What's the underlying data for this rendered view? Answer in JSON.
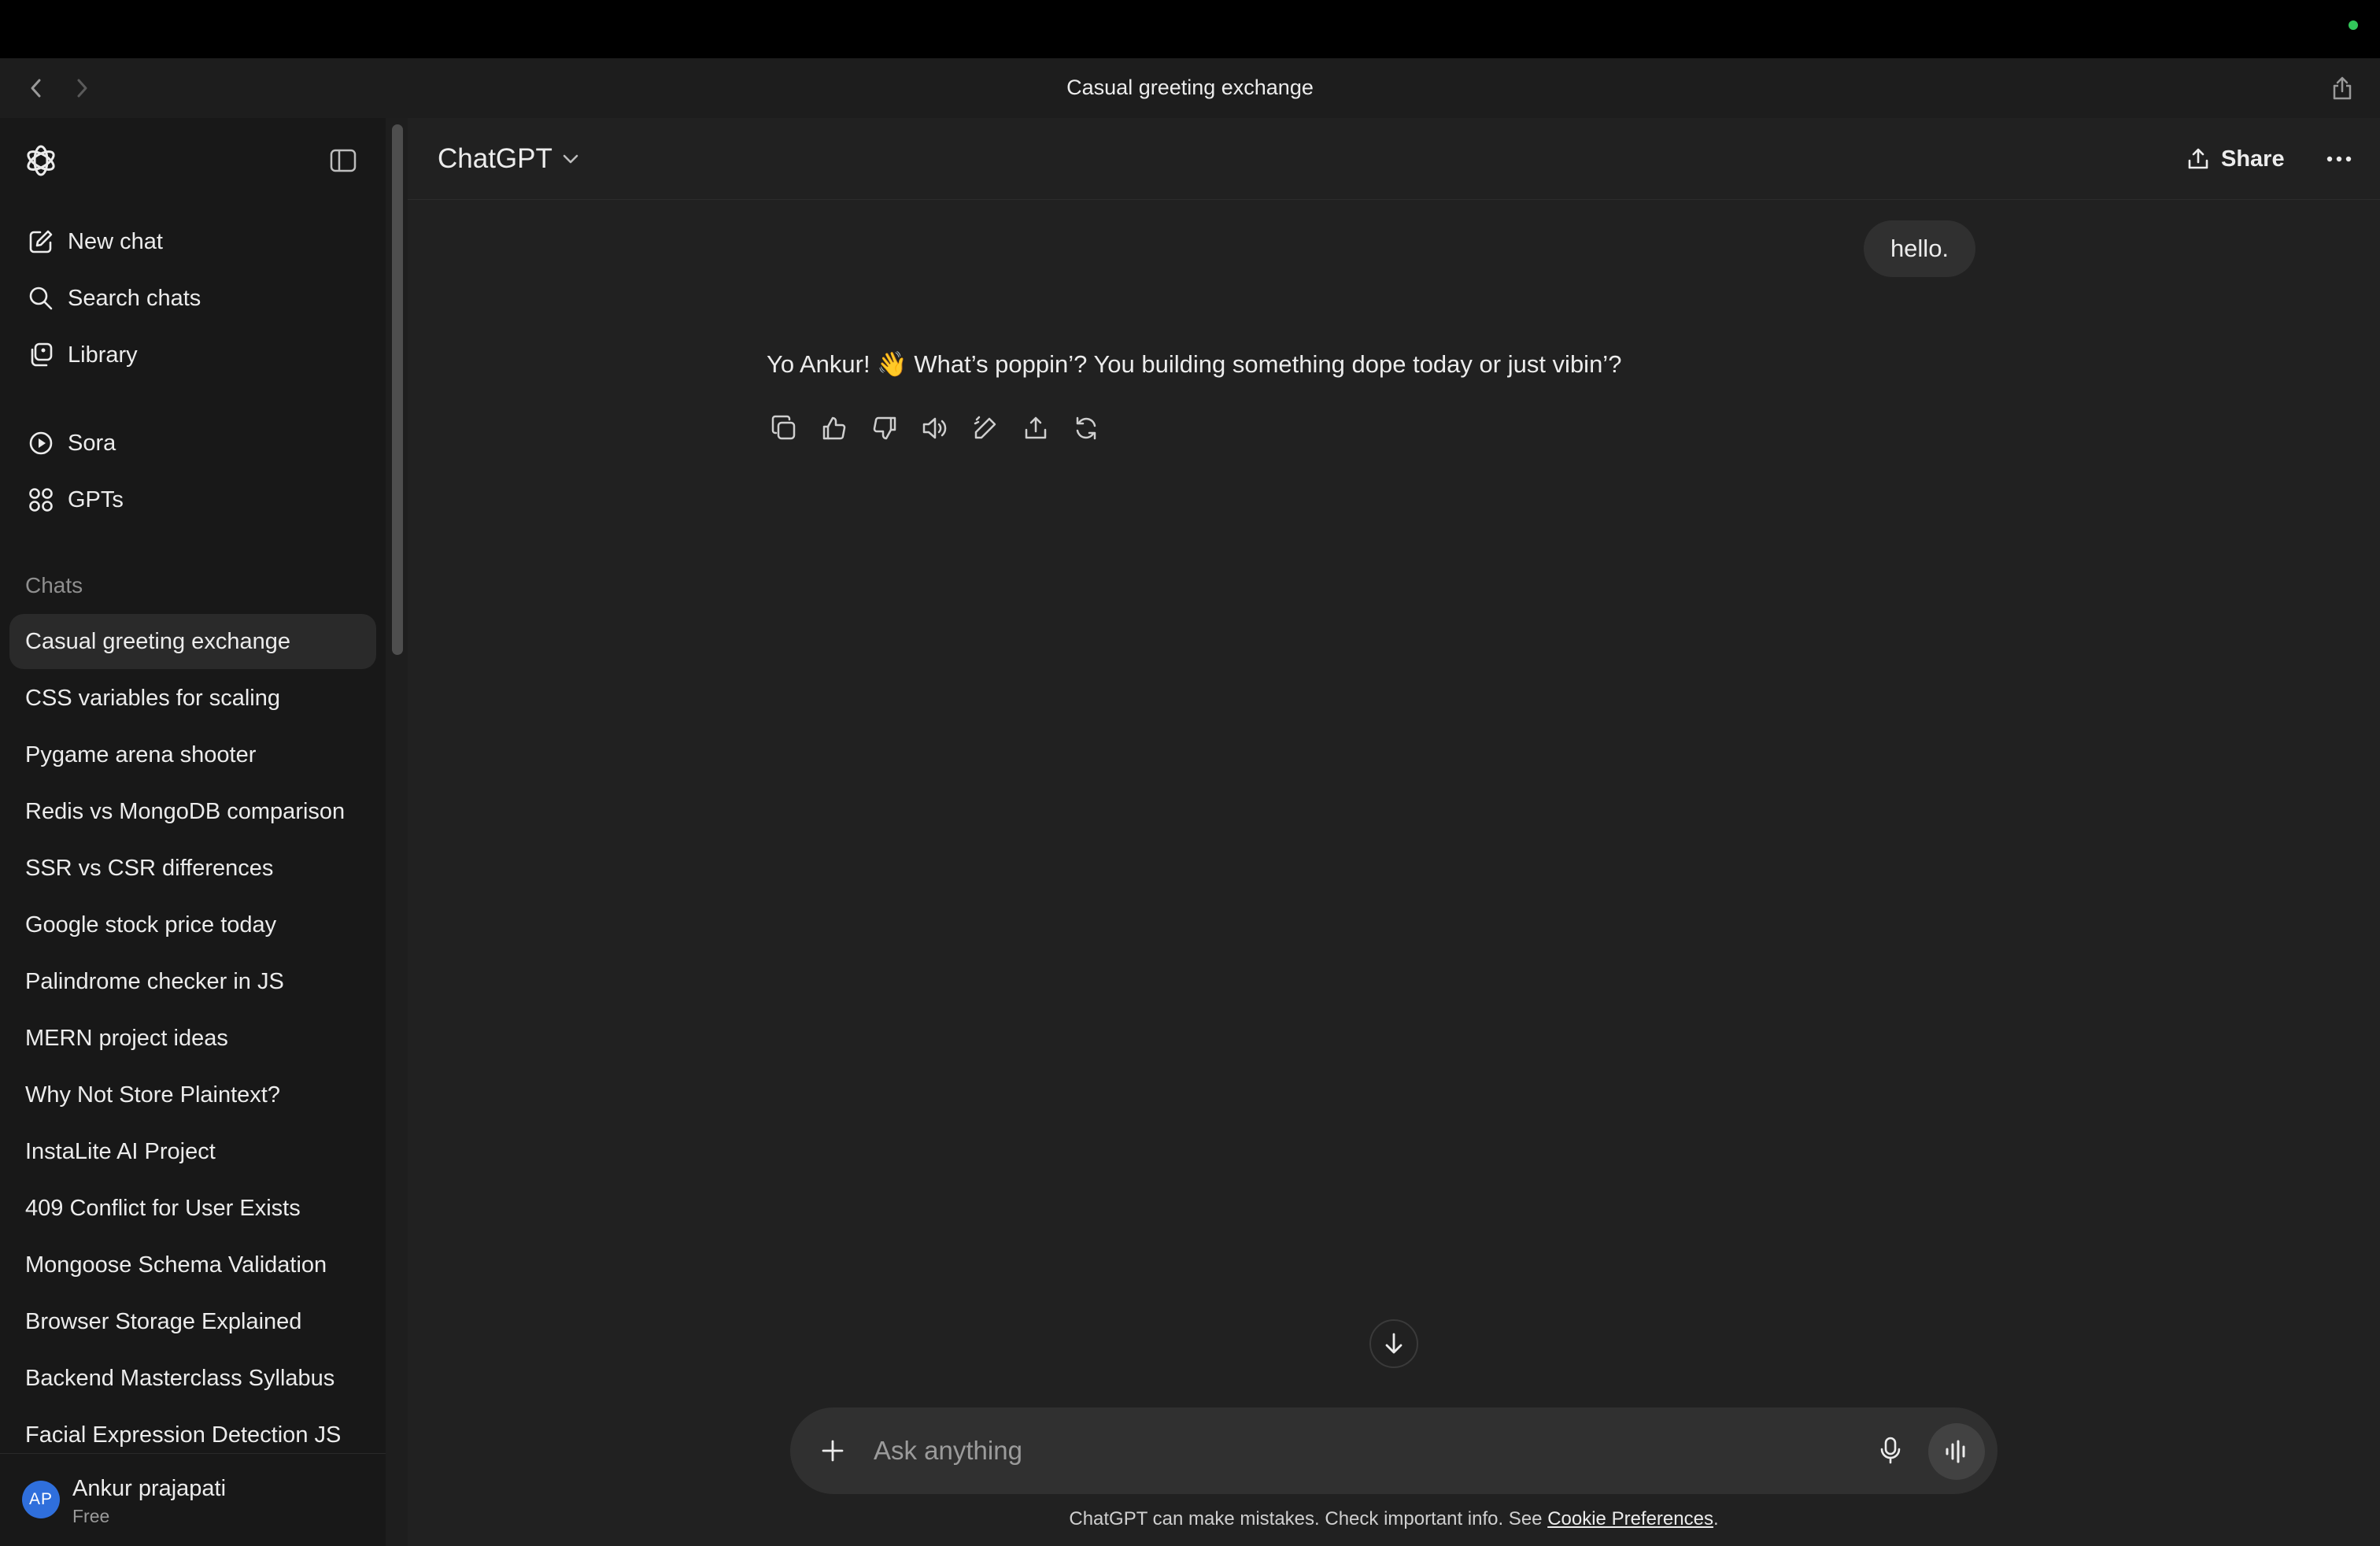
{
  "window": {
    "title": "Casual greeting exchange",
    "status_dot_color": "#32c75a"
  },
  "sidebar": {
    "nav": [
      {
        "label": "New chat",
        "icon": "edit-icon"
      },
      {
        "label": "Search chats",
        "icon": "search-icon"
      },
      {
        "label": "Library",
        "icon": "library-icon"
      },
      {
        "label": "Sora",
        "icon": "play-circle-icon"
      },
      {
        "label": "GPTs",
        "icon": "grid-icon"
      }
    ],
    "chats_label": "Chats",
    "chats": [
      "Casual greeting exchange",
      "CSS variables for scaling",
      "Pygame arena shooter",
      "Redis vs MongoDB comparison",
      "SSR vs CSR differences",
      "Google stock price today",
      "Palindrome checker in JS",
      "MERN project ideas",
      "Why Not Store Plaintext?",
      "InstaLite AI Project",
      "409 Conflict for User Exists",
      "Mongoose Schema Validation",
      "Browser Storage Explained",
      "Backend Masterclass Syllabus",
      "Facial Expression Detection JS"
    ],
    "active_chat": "Casual greeting exchange",
    "user": {
      "initials": "AP",
      "name": "Ankur prajapati",
      "plan": "Free"
    }
  },
  "header": {
    "model": "ChatGPT",
    "share_label": "Share"
  },
  "conversation": {
    "user_message": "hello.",
    "assistant_message": "Yo Ankur! 👋 What’s poppin’? You building something dope today or just vibin’?",
    "actions": [
      "copy-icon",
      "thumbs-up-icon",
      "thumbs-down-icon",
      "read-aloud-icon",
      "edit-pen-icon",
      "share-icon",
      "regenerate-icon"
    ]
  },
  "composer": {
    "placeholder": "Ask anything"
  },
  "footer": {
    "disclaimer_prefix": "ChatGPT can make mistakes. Check important info. See ",
    "disclaimer_link": "Cookie Preferences",
    "disclaimer_suffix": "."
  }
}
